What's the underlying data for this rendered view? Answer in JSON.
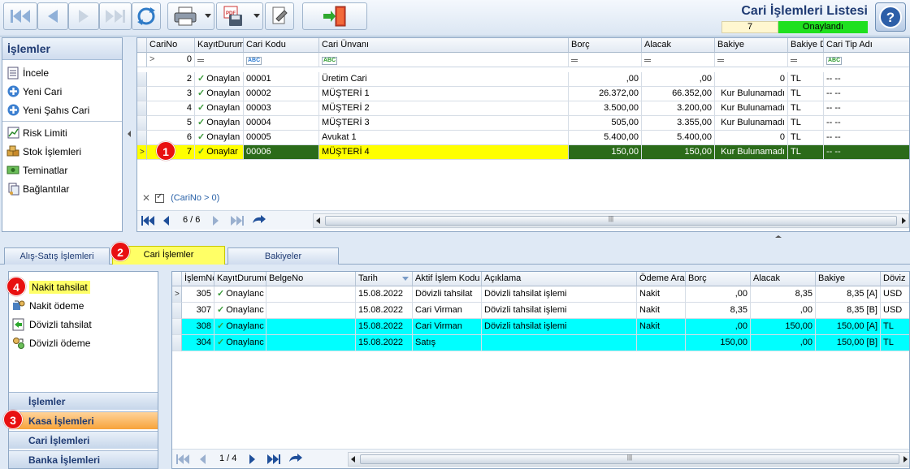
{
  "app": {
    "title": "Cari İşlemleri Listesi",
    "record_count": "7",
    "record_status": "Onaylandı"
  },
  "colors": {
    "accent_title": "#1f3b73",
    "status_green": "#1fe01f",
    "selected_row": "#ffff00",
    "selected_dark": "#2b6b1a",
    "cyan_row": "#00ffff",
    "active_group": "#f7a33a",
    "callout": "#e81010"
  },
  "toolbar": {
    "icons": [
      "first-icon",
      "prev-icon",
      "next-icon",
      "last-icon",
      "refresh-icon",
      "print-icon",
      "pdf-save-icon",
      "settings-icon",
      "exit-icon",
      "help-icon"
    ]
  },
  "left_panel": {
    "title": "İşlemler",
    "items": [
      {
        "label": "İncele",
        "icon": "document-icon"
      },
      {
        "label": "Yeni Cari",
        "icon": "plus-icon"
      },
      {
        "label": "Yeni Şahıs Cari",
        "icon": "plus-icon"
      },
      {
        "label": "Risk Limiti",
        "icon": "chart-icon"
      },
      {
        "label": "Stok İşlemleri",
        "icon": "boxes-icon"
      },
      {
        "label": "Teminatlar",
        "icon": "money-icon"
      },
      {
        "label": "Bağlantılar",
        "icon": "links-icon"
      }
    ]
  },
  "top_grid": {
    "columns": [
      "CariNo",
      "KayıtDurumu",
      "Cari Kodu",
      "Cari Ünvanı",
      "Borç",
      "Alacak",
      "Bakiye",
      "Bakiye D",
      "Cari Tip Adı"
    ],
    "filter_row": {
      "carino": "0"
    },
    "rows": [
      {
        "carino": "2",
        "durum": "Onaylan",
        "kod": "00001",
        "unvan": "Üretim Cari",
        "borc": ",00",
        "alacak": ",00",
        "bakiye": "0",
        "bd": "TL",
        "tip": "-- --"
      },
      {
        "carino": "3",
        "durum": "Onaylan",
        "kod": "00002",
        "unvan": "MÜŞTERİ 1",
        "borc": "26.372,00",
        "alacak": "66.352,00",
        "bakiye": "Kur Bulunamadı",
        "bd": "TL",
        "tip": "-- --"
      },
      {
        "carino": "4",
        "durum": "Onaylan",
        "kod": "00003",
        "unvan": "MÜŞTERİ 2",
        "borc": "3.500,00",
        "alacak": "3.200,00",
        "bakiye": "Kur Bulunamadı",
        "bd": "TL",
        "tip": "-- --"
      },
      {
        "carino": "5",
        "durum": "Onaylan",
        "kod": "00004",
        "unvan": "MÜŞTERİ 3",
        "borc": "505,00",
        "alacak": "3.355,00",
        "bakiye": "Kur Bulunamadı",
        "bd": "TL",
        "tip": "-- --"
      },
      {
        "carino": "6",
        "durum": "Onaylan",
        "kod": "00005",
        "unvan": "Avukat 1",
        "borc": "5.400,00",
        "alacak": "5.400,00",
        "bakiye": "0",
        "bd": "TL",
        "tip": "-- --"
      },
      {
        "carino": "7",
        "durum": "Onaylar",
        "kod": "00006",
        "unvan": "MÜŞTERİ 4",
        "borc": "150,00",
        "alacak": "150,00",
        "bakiye": "Kur Bulunamadı",
        "bd": "TL",
        "tip": "-- --"
      }
    ],
    "filter_text": "(CariNo > 0)",
    "position": "6 / 6"
  },
  "tabs": [
    "Alış-Satış İşlemleri",
    "Cari İşlemler",
    "Bakiyeler"
  ],
  "actions": {
    "items": [
      {
        "label": "Nakit tahsilat",
        "icon": "cash-in-icon"
      },
      {
        "label": "Nakit ödeme",
        "icon": "cash-out-icon"
      },
      {
        "label": "Dövizli tahsilat",
        "icon": "fx-in-icon"
      },
      {
        "label": "Dövizli ödeme",
        "icon": "fx-out-icon"
      }
    ],
    "groups": [
      "İşlemler",
      "Kasa İşlemleri",
      "Cari İşlemleri",
      "Banka İşlemleri"
    ]
  },
  "bottom_grid": {
    "columns": [
      "İşlemNo",
      "KayıtDurumu",
      "BelgeNo",
      "Tarih",
      "Aktif İşlem Kodu",
      "Açıklama",
      "Ödeme Arac",
      "Borç",
      "Alacak",
      "Bakiye",
      "Döviz"
    ],
    "rows": [
      {
        "no": "305",
        "durum": "Onaylanc",
        "belge": "",
        "tarih": "15.08.2022",
        "kod": "Dövizli tahsilat",
        "aciklama": "Dövizli tahsilat işlemi",
        "odeme": "Nakit",
        "borc": ",00",
        "alacak": "8,35",
        "bakiye": "8,35 [A]",
        "doviz": "USD"
      },
      {
        "no": "307",
        "durum": "Onaylanc",
        "belge": "",
        "tarih": "15.08.2022",
        "kod": "Cari Virman",
        "aciklama": "Dövizli tahsilat işlemi",
        "odeme": "Nakit",
        "borc": "8,35",
        "alacak": ",00",
        "bakiye": "8,35 [B]",
        "doviz": "USD"
      },
      {
        "no": "308",
        "durum": "Onaylanc",
        "belge": "",
        "tarih": "15.08.2022",
        "kod": "Cari Virman",
        "aciklama": "Dövizli tahsilat işlemi",
        "odeme": "Nakit",
        "borc": ",00",
        "alacak": "150,00",
        "bakiye": "150,00 [A]",
        "doviz": "TL"
      },
      {
        "no": "304",
        "durum": "Onaylanc",
        "belge": "",
        "tarih": "15.08.2022",
        "kod": "Satış",
        "aciklama": "",
        "odeme": "",
        "borc": "150,00",
        "alacak": ",00",
        "bakiye": "150,00 [B]",
        "doviz": "TL"
      }
    ],
    "position": "1 / 4"
  },
  "callouts": [
    "1",
    "2",
    "3",
    "4"
  ]
}
